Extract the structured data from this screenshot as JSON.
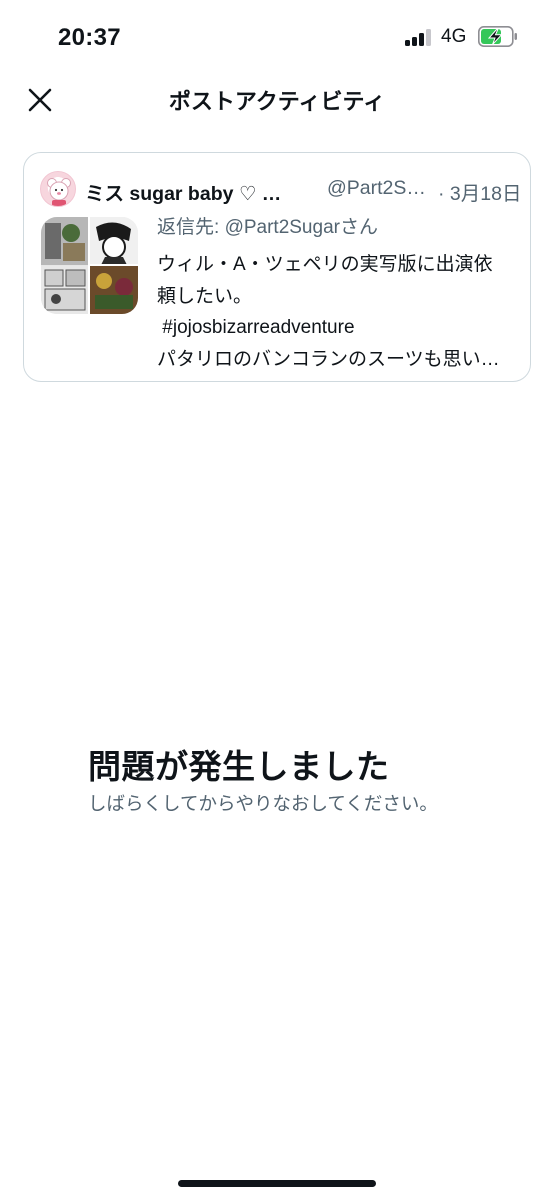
{
  "status_bar": {
    "time": "20:37",
    "network": "4G",
    "battery_charging": true,
    "battery_color": "#34c759"
  },
  "header": {
    "title": "ポストアクティビティ",
    "close_icon": "close-icon"
  },
  "post": {
    "display_name": "ミス sugar baby ♡ …",
    "handle": "@Part2S…",
    "date": "· 3月18日",
    "reply_prefix": "返信先: ",
    "reply_mention": "@Part2Sugarさん",
    "text_lines": [
      "ウィル・A・ツェペリの実写版に出演依",
      "頼したい。",
      " #jojosbizarreadventure",
      "パタリロのバンコランのスーツも思い…"
    ]
  },
  "error": {
    "title": "問題が発生しました",
    "message": "しばらくしてからやりなおしてください。"
  },
  "colors": {
    "text_primary": "#0f1419",
    "text_secondary": "#536471",
    "border": "#cfd9de"
  }
}
